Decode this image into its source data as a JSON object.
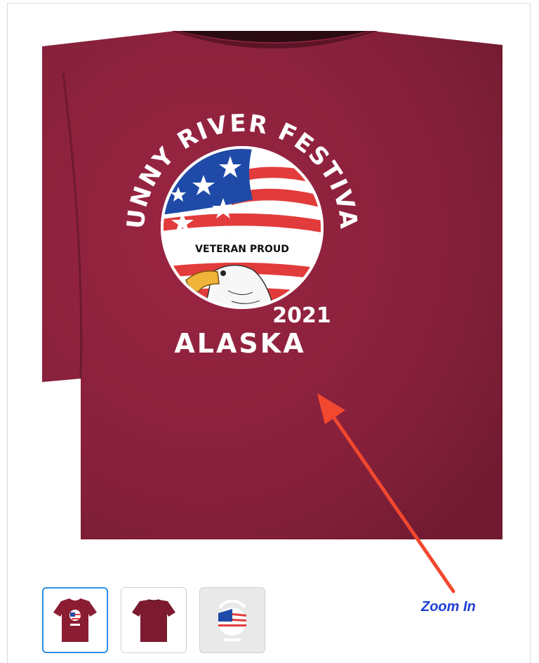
{
  "product": {
    "design": {
      "arc_text": "FUNNY RIVER FESTIVAL",
      "banner_text": "VETERAN PROUD",
      "year": "2021",
      "location": "ALASKA"
    },
    "shirt_color": "#8b1d33",
    "zoom_label": "Zoom In",
    "accent_color": "#2f8fe6",
    "link_color": "#1f3fd6",
    "annotation_color": "#f2482f",
    "thumbnails": [
      {
        "name": "front-view",
        "selected": true
      },
      {
        "name": "back-view",
        "selected": false
      },
      {
        "name": "design-artwork",
        "selected": false
      }
    ]
  }
}
